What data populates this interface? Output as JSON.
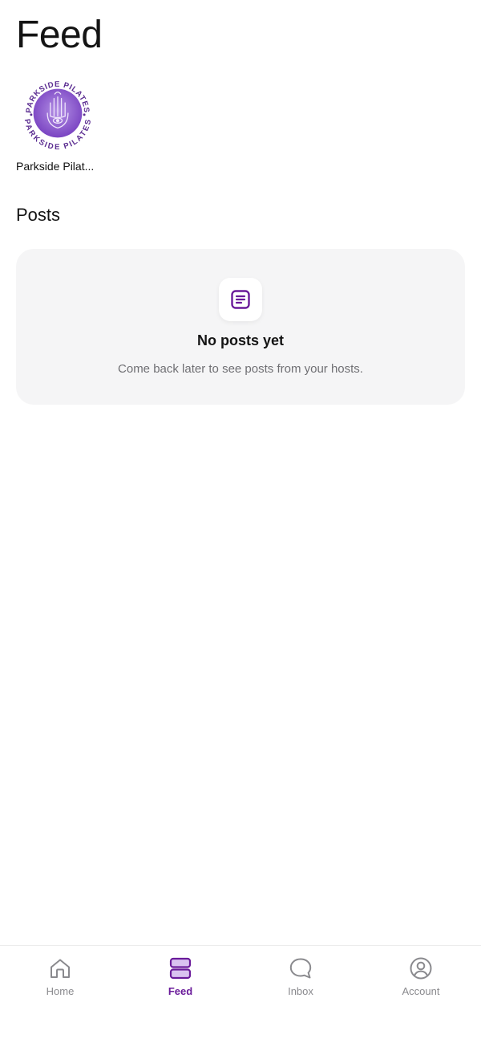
{
  "header": {
    "title": "Feed"
  },
  "hosts": [
    {
      "name": "Parkside Pilat...",
      "avatar_icon": "parkside-pilates-logo",
      "avatar_text": "PARKSIDE PILATES"
    }
  ],
  "posts": {
    "section_title": "Posts",
    "empty_state": {
      "icon": "document-icon",
      "title": "No posts yet",
      "subtitle": "Come back later to see posts from your hosts."
    }
  },
  "tab_bar": {
    "items": [
      {
        "label": "Home",
        "icon": "home-icon",
        "active": false
      },
      {
        "label": "Feed",
        "icon": "feed-icon",
        "active": true
      },
      {
        "label": "Inbox",
        "icon": "chat-bubble-icon",
        "active": false
      },
      {
        "label": "Account",
        "icon": "account-icon",
        "active": false
      }
    ]
  },
  "colors": {
    "accent": "#6a1b9a",
    "accent_light": "#d9c2f0",
    "inactive": "#8a8a8e",
    "card_background": "#f5f5f6",
    "logo_purple": "#8a5cc9"
  }
}
